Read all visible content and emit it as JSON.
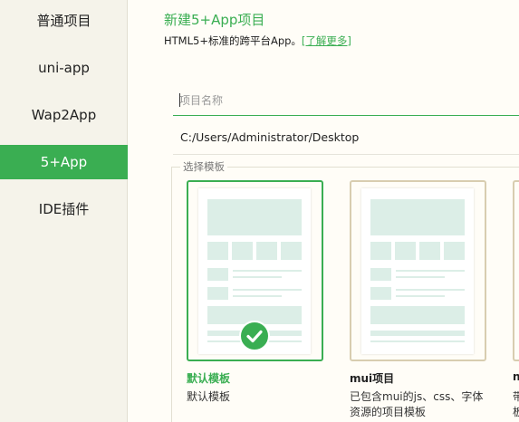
{
  "sidebar": {
    "items": [
      {
        "label": "普通项目",
        "active": false
      },
      {
        "label": "uni-app",
        "active": false
      },
      {
        "label": "Wap2App",
        "active": false
      },
      {
        "label": "5+App",
        "active": true
      },
      {
        "label": "IDE插件",
        "active": false
      }
    ]
  },
  "header": {
    "title": "新建5+App项目",
    "subtitle": "HTML5+标准的跨平台App。",
    "learn_more": "[了解更多]"
  },
  "form": {
    "name_placeholder": "项目名称",
    "name_value": "",
    "path_value": "C:/Users/Administrator/Desktop"
  },
  "templates": {
    "legend": "选择模板",
    "items": [
      {
        "name": "默认模板",
        "desc_line1": "默认模板",
        "desc_line2": "",
        "selected": true
      },
      {
        "name": "mui项目",
        "desc_line1": "已包含mui的js、css、字体",
        "desc_line2": "资源的项目模板",
        "selected": false
      },
      {
        "name": "n",
        "desc_line1": "带",
        "desc_line2": "板",
        "selected": false
      }
    ]
  },
  "colors": {
    "accent": "#3aae52",
    "sidebar_bg": "#f5f3ea",
    "placeholder_block": "#dceee7"
  },
  "icons": {
    "selected_check": "check-circle-icon"
  }
}
